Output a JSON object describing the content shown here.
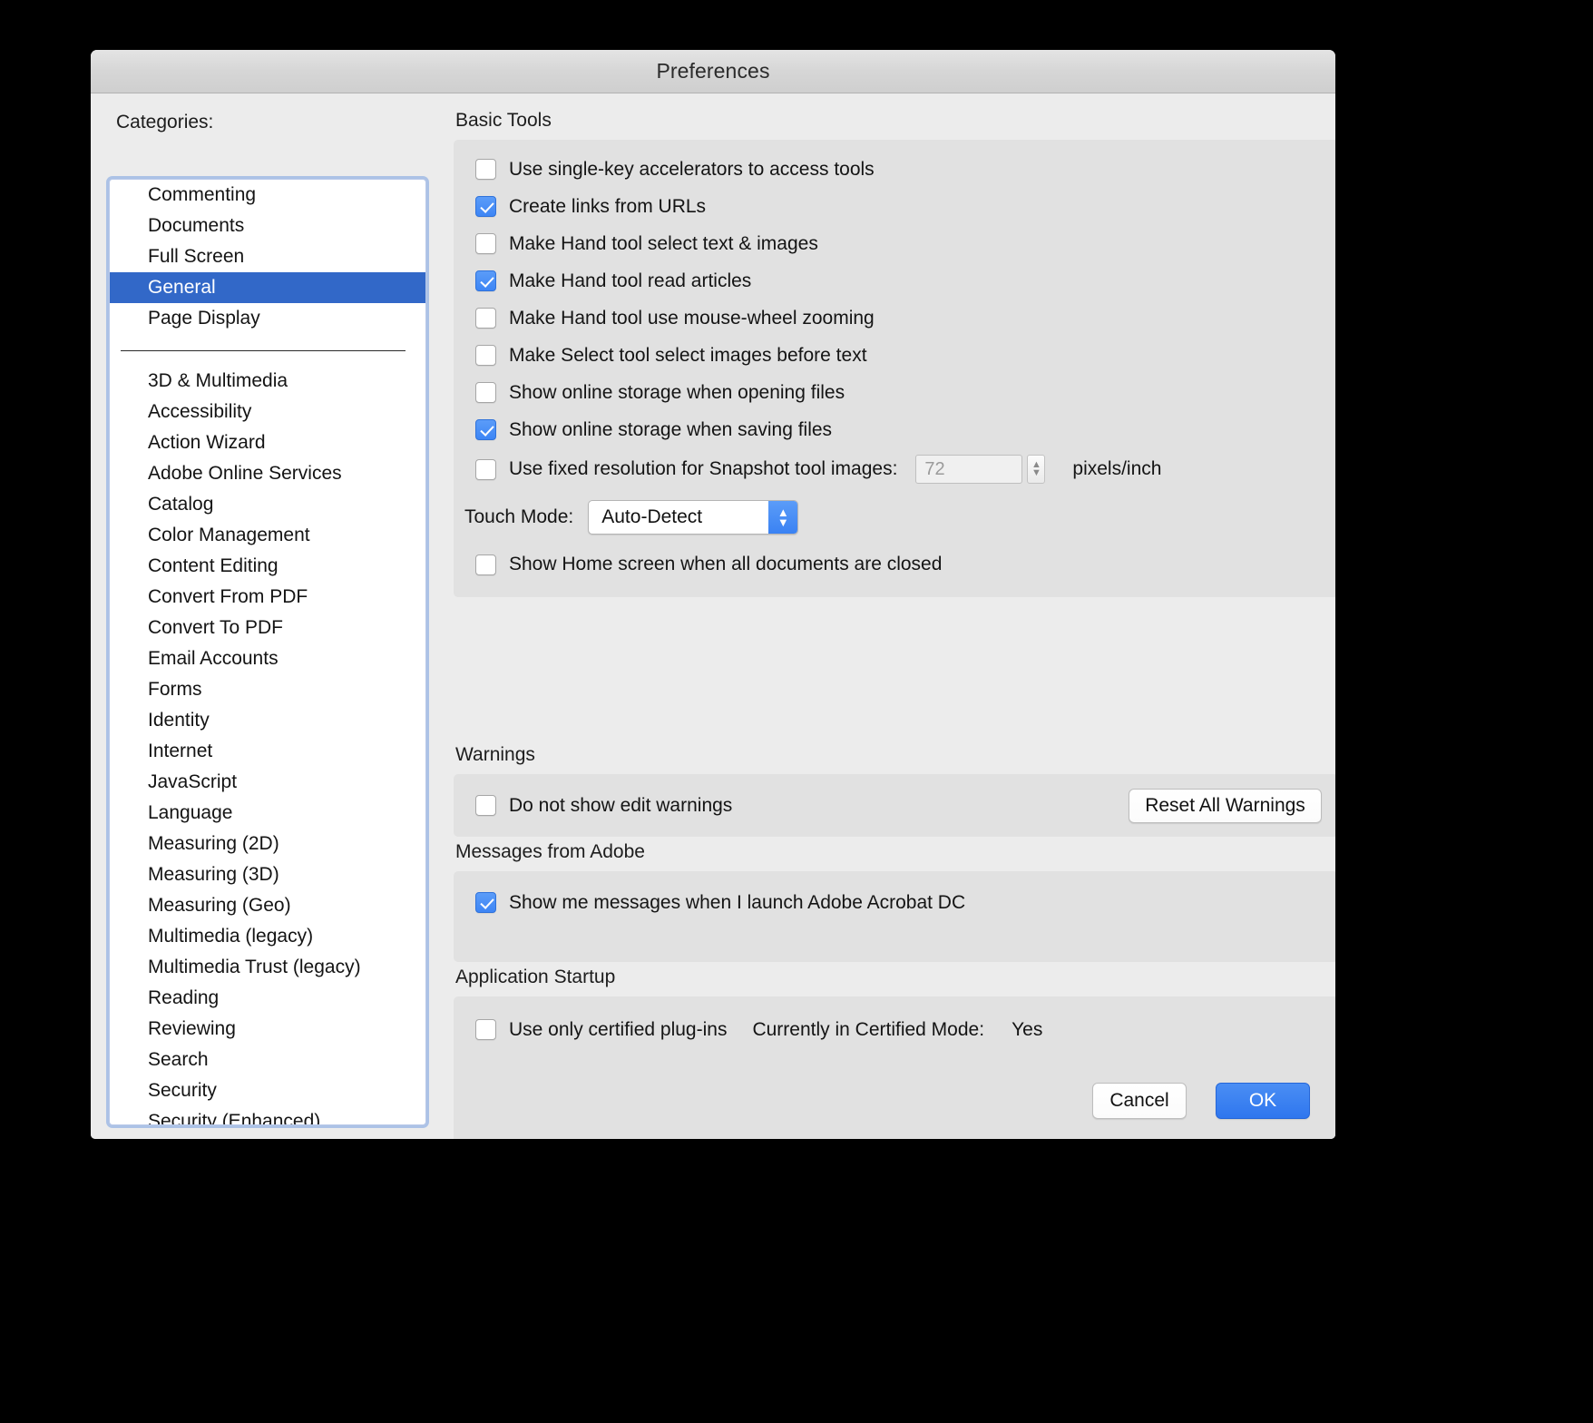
{
  "window": {
    "title": "Preferences"
  },
  "sidebar": {
    "label": "Categories:",
    "primary_items": [
      {
        "label": "Commenting",
        "selected": false
      },
      {
        "label": "Documents",
        "selected": false
      },
      {
        "label": "Full Screen",
        "selected": false
      },
      {
        "label": "General",
        "selected": true
      },
      {
        "label": "Page Display",
        "selected": false
      }
    ],
    "secondary_items": [
      {
        "label": "3D & Multimedia"
      },
      {
        "label": "Accessibility"
      },
      {
        "label": "Action Wizard"
      },
      {
        "label": "Adobe Online Services"
      },
      {
        "label": "Catalog"
      },
      {
        "label": "Color Management"
      },
      {
        "label": "Content Editing"
      },
      {
        "label": "Convert From PDF"
      },
      {
        "label": "Convert To PDF"
      },
      {
        "label": "Email Accounts"
      },
      {
        "label": "Forms"
      },
      {
        "label": "Identity"
      },
      {
        "label": "Internet"
      },
      {
        "label": "JavaScript"
      },
      {
        "label": "Language"
      },
      {
        "label": "Measuring (2D)"
      },
      {
        "label": "Measuring (3D)"
      },
      {
        "label": "Measuring (Geo)"
      },
      {
        "label": "Multimedia (legacy)"
      },
      {
        "label": "Multimedia Trust (legacy)"
      },
      {
        "label": "Reading"
      },
      {
        "label": "Reviewing"
      },
      {
        "label": "Search"
      },
      {
        "label": "Security"
      },
      {
        "label": "Security (Enhanced)"
      }
    ]
  },
  "basic_tools": {
    "title": "Basic Tools",
    "checkboxes": [
      {
        "label": "Use single-key accelerators to access tools",
        "checked": false
      },
      {
        "label": "Create links from URLs",
        "checked": true
      },
      {
        "label": "Make Hand tool select text & images",
        "checked": false
      },
      {
        "label": "Make Hand tool read articles",
        "checked": true
      },
      {
        "label": "Make Hand tool use mouse-wheel zooming",
        "checked": false
      },
      {
        "label": "Make Select tool select images before text",
        "checked": false
      },
      {
        "label": "Show online storage when opening files",
        "checked": false
      },
      {
        "label": "Show online storage when saving files",
        "checked": true
      }
    ],
    "resolution": {
      "label": "Use fixed resolution for Snapshot tool images:",
      "checked": false,
      "value": "72",
      "unit": "pixels/inch"
    },
    "touch_mode": {
      "label": "Touch Mode:",
      "value": "Auto-Detect"
    },
    "home_screen": {
      "label": "Show Home screen when all documents are closed",
      "checked": false
    }
  },
  "warnings": {
    "title": "Warnings",
    "checkbox": {
      "label": "Do not show edit warnings",
      "checked": false
    },
    "reset_button": "Reset All Warnings"
  },
  "messages": {
    "title": "Messages from Adobe",
    "checkbox": {
      "label": "Show me messages when I launch Adobe Acrobat DC",
      "checked": true
    }
  },
  "startup": {
    "title": "Application Startup",
    "checkbox": {
      "label": "Use only certified plug-ins",
      "checked": false
    },
    "certified_mode_label": "Currently in Certified Mode:",
    "certified_mode_value": "Yes"
  },
  "footer": {
    "cancel": "Cancel",
    "ok": "OK"
  },
  "colors": {
    "accent": "#3268c8",
    "checkbox_checked": "#3d85f5",
    "default_button": "#2f76ee"
  }
}
